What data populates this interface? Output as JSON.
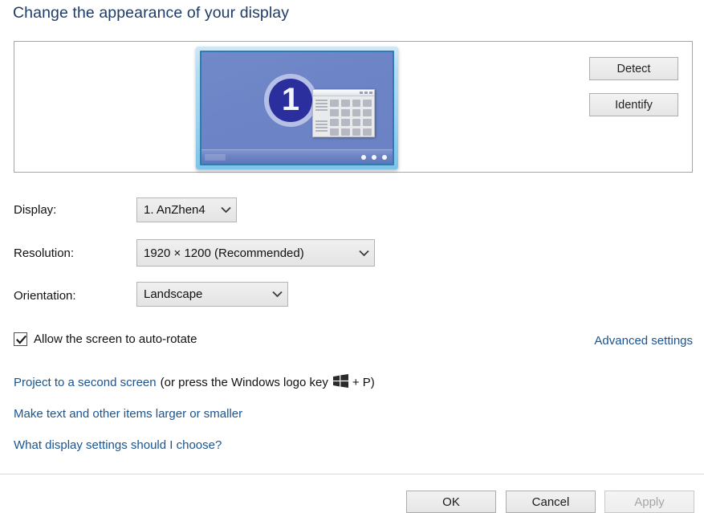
{
  "page": {
    "title": "Change the appearance of your display"
  },
  "preview": {
    "detect_label": "Detect",
    "identify_label": "Identify",
    "monitor_number": "1"
  },
  "form": {
    "display": {
      "label": "Display:",
      "value": "1. AnZhen4"
    },
    "resolution": {
      "label": "Resolution:",
      "value": "1920 × 1200 (Recommended)"
    },
    "orientation": {
      "label": "Orientation:",
      "value": "Landscape"
    }
  },
  "auto_rotate": {
    "label": "Allow the screen to auto-rotate",
    "checked": true
  },
  "links": {
    "advanced_settings": "Advanced settings",
    "project_link": "Project to a second screen",
    "project_suffix_before": "(or press the Windows logo key",
    "project_suffix_after": "+ P)",
    "make_text": "Make text and other items larger or smaller",
    "what_display": "What display settings should I choose?"
  },
  "footer": {
    "ok_label": "OK",
    "cancel_label": "Cancel",
    "apply_label": "Apply",
    "apply_enabled": false
  },
  "colors": {
    "title_blue": "#1f3c66",
    "link_blue": "#1a548f",
    "monitor_screen": "#6d84c6",
    "badge_blue": "#2b2f9e",
    "bezel_blue": "#9ed4f2"
  }
}
